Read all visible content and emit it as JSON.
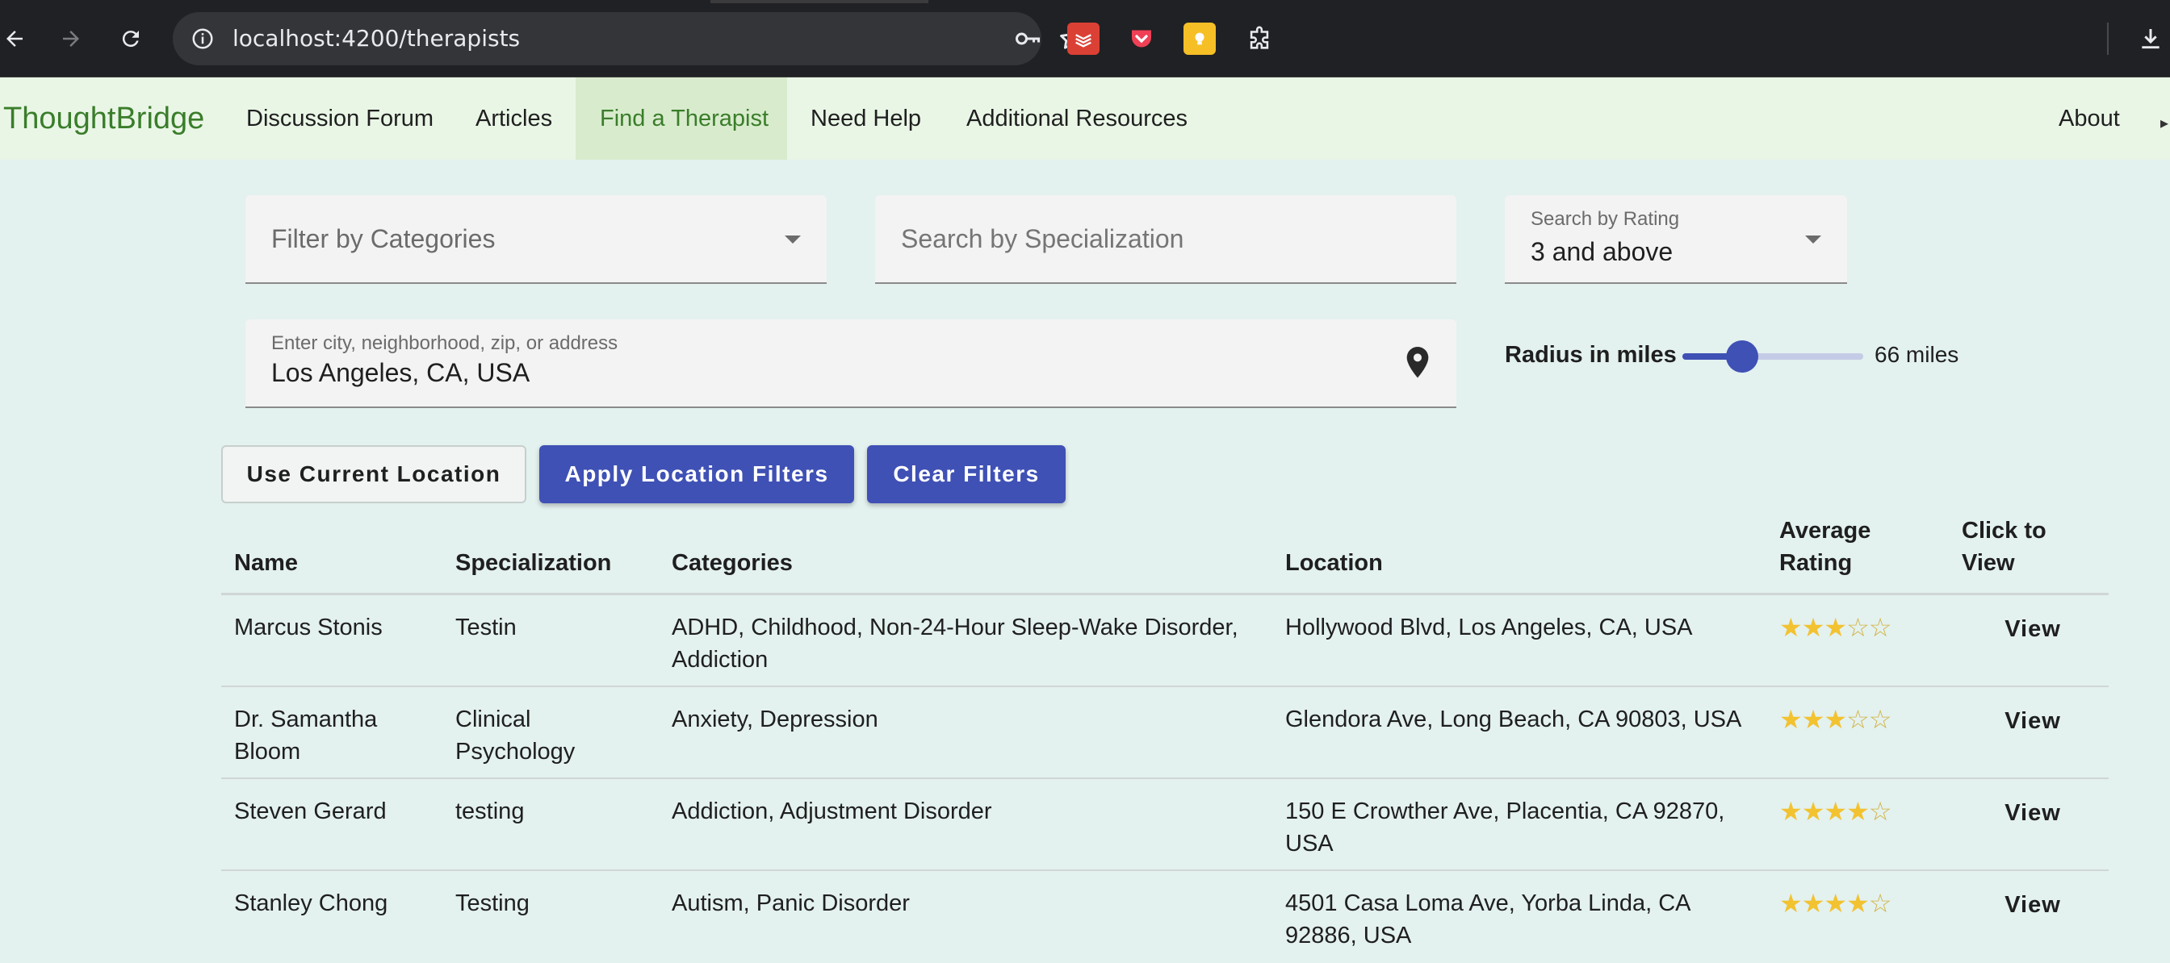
{
  "browser": {
    "url": "localhost:4200/therapists",
    "icons": [
      "back-arrow-icon",
      "forward-arrow-icon",
      "reload-icon",
      "site-info-icon",
      "password-key-icon",
      "bookmark-star-icon",
      "todoist-extension-icon",
      "pocket-extension-icon",
      "keep-extension-icon",
      "extensions-puzzle-icon",
      "download-icon"
    ]
  },
  "navbar": {
    "brand": "ThoughtBridge",
    "items": [
      {
        "label": "Discussion Forum"
      },
      {
        "label": "Articles"
      },
      {
        "label": "Find a Therapist",
        "active": true
      },
      {
        "label": "Need Help"
      },
      {
        "label": "Additional Resources"
      }
    ],
    "right_item": "About"
  },
  "filters": {
    "categories_placeholder": "Filter by Categories",
    "specialization_placeholder": "Search by Specialization",
    "rating_label": "Search by Rating",
    "rating_value": "3 and above",
    "location_label": "Enter city, neighborhood, zip, or address",
    "location_value": "Los Angeles, CA, USA",
    "radius_label": "Radius in miles",
    "radius_value_text": "66 miles",
    "radius_fraction": 0.33
  },
  "buttons": {
    "use_location": "Use Current Location",
    "apply": "Apply Location Filters",
    "clear": "Clear Filters"
  },
  "table": {
    "headers": {
      "name": "Name",
      "specialization": "Specialization",
      "categories": "Categories",
      "location": "Location",
      "avg_rating_1": "Average",
      "avg_rating_2": "Rating",
      "view_1": "Click to",
      "view_2": "View"
    },
    "rows": [
      {
        "name": "Marcus Stonis",
        "specialization": "Testin",
        "categories": "ADHD, Childhood, Non-24-Hour Sleep-Wake Disorder, Addiction",
        "location": "Hollywood Blvd, Los Angeles, CA, USA",
        "rating": 3,
        "view": "View"
      },
      {
        "name": "Dr. Samantha Bloom",
        "specialization": "Clinical Psychology",
        "categories": "Anxiety, Depression",
        "location": "Glendora Ave, Long Beach, CA 90803, USA",
        "rating": 3,
        "view": "View"
      },
      {
        "name": "Steven Gerard",
        "specialization": "testing",
        "categories": "Addiction, Adjustment Disorder",
        "location": "150 E Crowther Ave, Placentia, CA 92870, USA",
        "rating": 4,
        "view": "View"
      },
      {
        "name": "Stanley Chong",
        "specialization": "Testing",
        "categories": "Autism, Panic Disorder",
        "location": "4501 Casa Loma Ave, Yorba Linda, CA 92886, USA",
        "rating": 4,
        "view": "View"
      }
    ],
    "rating_max": 5
  },
  "colors": {
    "primary": "#3f51b5",
    "brand_green": "#3a7d2a",
    "star": "#f2c230"
  }
}
